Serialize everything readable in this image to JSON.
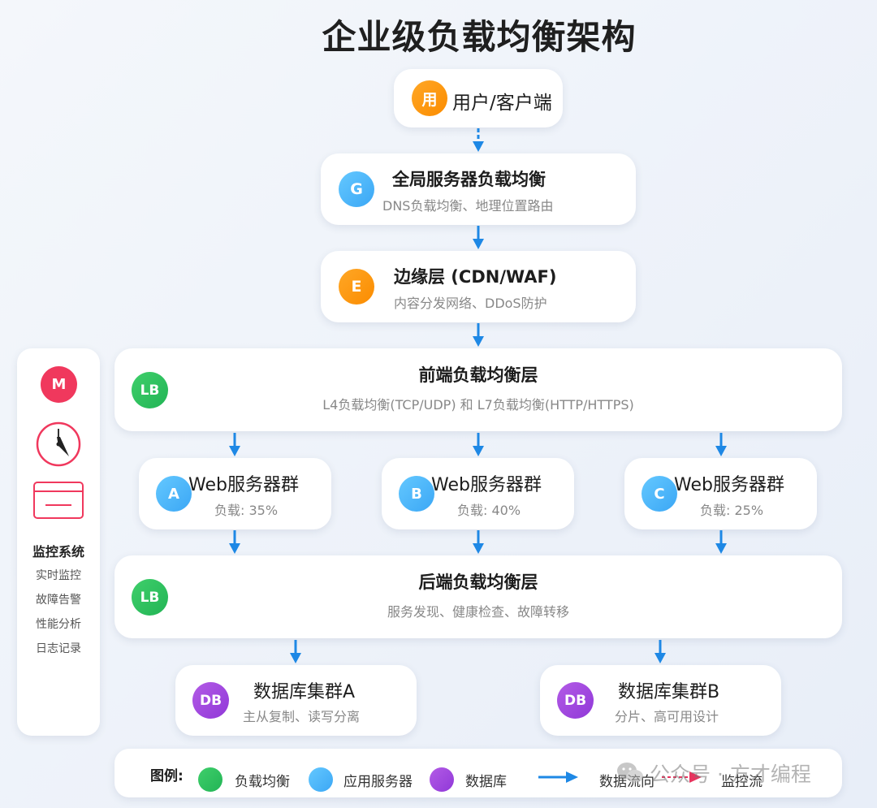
{
  "title": "企业级负载均衡架构",
  "client": {
    "icon": "用",
    "label": "用户/客户端"
  },
  "gslb": {
    "icon": "G",
    "title": "全局服务器负载均衡",
    "subtitle": "DNS负载均衡、地理位置路由"
  },
  "edge": {
    "icon": "E",
    "title": "边缘层 (CDN/WAF)",
    "subtitle": "内容分发网络、DDoS防护"
  },
  "frontend_lb": {
    "icon": "LB",
    "title": "前端负载均衡层",
    "subtitle": "L4负载均衡(TCP/UDP) 和 L7负载均衡(HTTP/HTTPS)"
  },
  "web_clusters": [
    {
      "icon": "A",
      "title": "Web服务器群",
      "load": "负载: 35%"
    },
    {
      "icon": "B",
      "title": "Web服务器群",
      "load": "负载: 40%"
    },
    {
      "icon": "C",
      "title": "Web服务器群",
      "load": "负载: 25%"
    }
  ],
  "backend_lb": {
    "icon": "LB",
    "title": "后端负载均衡层",
    "subtitle": "服务发现、健康检查、故障转移"
  },
  "databases": [
    {
      "icon": "DB",
      "title": "数据库集群A",
      "subtitle": "主从复制、读写分离"
    },
    {
      "icon": "DB",
      "title": "数据库集群B",
      "subtitle": "分片、高可用设计"
    }
  ],
  "monitor": {
    "icon": "M",
    "title": "监控系统",
    "items": [
      "实时监控",
      "故障告警",
      "性能分析",
      "日志记录"
    ]
  },
  "legend": {
    "title": "图例:",
    "items": [
      "负载均衡",
      "应用服务器",
      "数据库",
      "数据流向",
      "监控流"
    ]
  },
  "watermark": "公众号 · 方才编程",
  "colors": {
    "orange": "#fb8c00",
    "blue": "#3ba7f5",
    "green": "#22b455",
    "purple": "#9038d8",
    "red": "#f0385d",
    "arrow": "#1e88e5"
  }
}
